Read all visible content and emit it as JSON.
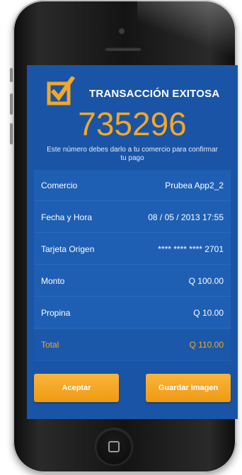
{
  "header": {
    "title": "TRANSACCIÓN EXITOSA",
    "icon": "checkbox-checked-icon"
  },
  "transaction": {
    "code": "735296",
    "note": "Este número debes darlo a tu comercio para confirmar tu pago"
  },
  "details": [
    {
      "label": "Comercio",
      "value": "Prubea App2_2"
    },
    {
      "label": "Fecha y Hora",
      "value": "08 / 05 / 2013  17:55"
    },
    {
      "label": "Tarjeta Origen",
      "value": "**** **** **** 2701"
    },
    {
      "label": "Monto",
      "value": "Q 100.00"
    },
    {
      "label": "Propina",
      "value": "Q 10.00"
    },
    {
      "label": "Total",
      "value": "Q 110.00"
    }
  ],
  "buttons": {
    "accept": "Aceptar",
    "save_image": "Guardar Imagen"
  },
  "colors": {
    "screen_bg": "#1a54a6",
    "accent": "#f3a726",
    "text": "#ffffff"
  }
}
